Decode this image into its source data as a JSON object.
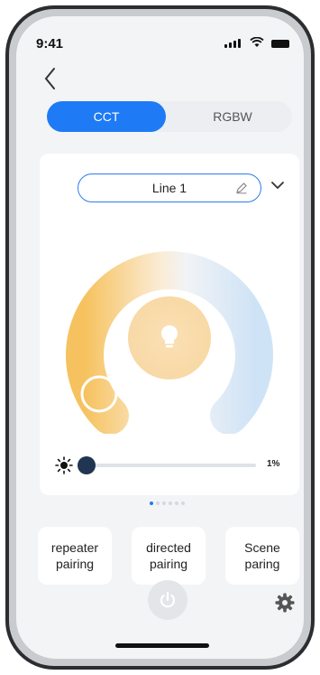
{
  "status": {
    "time": "9:41"
  },
  "segment": {
    "active": "CCT",
    "inactive": "RGBW"
  },
  "light": {
    "name": "Line 1"
  },
  "brightness": {
    "label": "1%",
    "value_percent": 1
  },
  "pager": {
    "count": 6,
    "active_index": 0
  },
  "actions": [
    {
      "line1": "repeater",
      "line2": "pairing"
    },
    {
      "line1": "directed",
      "line2": "pairing"
    },
    {
      "line1": "Scene",
      "line2": "paring"
    }
  ],
  "icons": {
    "back": "chevron-left-icon",
    "edit": "pencil-icon",
    "dropdown": "chevron-down-icon",
    "bulb": "lightbulb-icon",
    "sun": "sun-icon",
    "power": "power-icon",
    "settings": "gear-icon"
  },
  "colors": {
    "accent": "#1e7bf5",
    "warm": "#f6c25f",
    "cool": "#cfe3f6",
    "knob": "#1f3552"
  }
}
